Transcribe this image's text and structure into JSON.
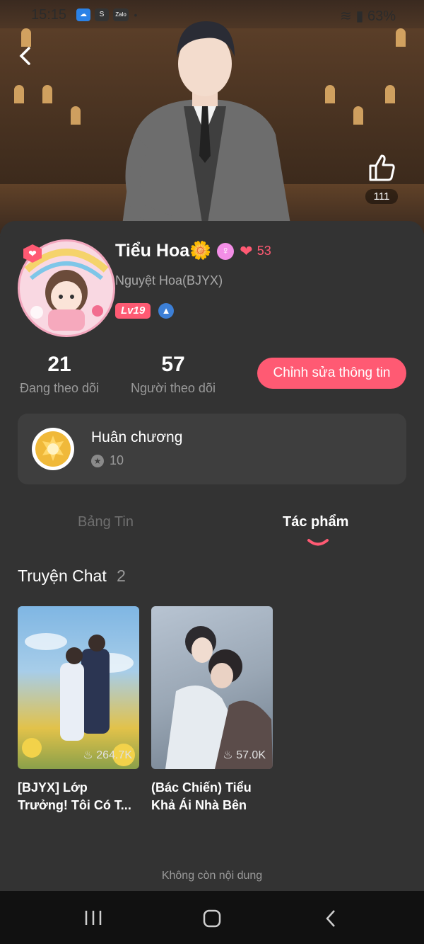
{
  "status_bar": {
    "time": "15:15",
    "battery": "63%",
    "app_icons": [
      "cloud-icon",
      "s-icon",
      "zalo-icon"
    ],
    "zalo": "Zalo"
  },
  "header": {
    "likes": "111"
  },
  "profile": {
    "display_name": "Tiểu Hoa🌼",
    "popularity": "53",
    "username": "Nguyệt Hoa(BJYX)",
    "level": "Lv19",
    "following_count": "21",
    "following_label": "Đang theo dõi",
    "followers_count": "57",
    "followers_label": "Người theo dõi",
    "edit_label": "Chỉnh sửa thông tin"
  },
  "medals": {
    "title": "Huân chương",
    "count": "10"
  },
  "tabs": [
    {
      "label": "Bảng Tin",
      "active": false
    },
    {
      "label": "Tác phẩm",
      "active": true
    }
  ],
  "section": {
    "title": "Truyện Chat",
    "count": "2"
  },
  "works": [
    {
      "title": "[BJYX] Lớp Trưởng! Tôi Có T...",
      "views": "264.7K"
    },
    {
      "title": "(Bác Chiến) Tiểu Khả Ái Nhà Bên",
      "views": "57.0K"
    }
  ],
  "footer": {
    "end_text": "Không còn nội dung"
  },
  "colors": {
    "accent": "#ff5a73",
    "background": "#333333",
    "card": "#3e3e3e"
  }
}
